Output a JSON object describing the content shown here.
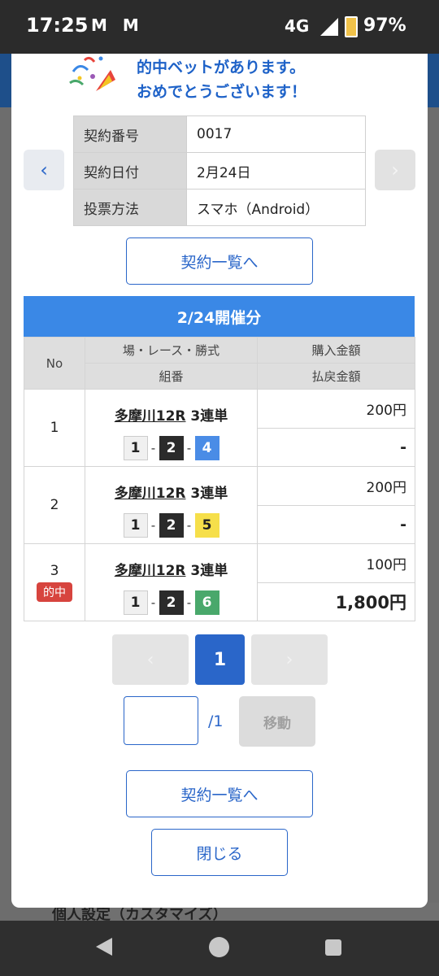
{
  "status_bar": {
    "time": "17:25",
    "notification_icons": "M M",
    "network": "4G",
    "battery": "97%"
  },
  "celebration": {
    "line1": "的中ベットがあります。",
    "line2": "おめでとうございます！"
  },
  "contract": {
    "rows": [
      {
        "label": "契約番号",
        "value": "0017"
      },
      {
        "label": "契約日付",
        "value": "2月24日"
      },
      {
        "label": "投票方法",
        "value": "スマホ（Android）"
      }
    ],
    "prev_icon": "‹",
    "next_icon": "›"
  },
  "list_button_label": "契約一覧へ",
  "section_title": "2/24開催分",
  "bet_table": {
    "headers": {
      "no": "No",
      "race": "場・レース・勝式",
      "combo": "組番",
      "purchase": "購入金額",
      "payout": "払戻金額"
    },
    "rows": [
      {
        "no": "1",
        "venue": "多摩川12R",
        "bet_type": "3連単",
        "first": "1",
        "second": "2",
        "third": "4",
        "amount": "200円",
        "payout": "-",
        "hit": ""
      },
      {
        "no": "2",
        "venue": "多摩川12R",
        "bet_type": "3連単",
        "first": "1",
        "second": "2",
        "third": "5",
        "amount": "200円",
        "payout": "-",
        "hit": ""
      },
      {
        "no": "3",
        "venue": "多摩川12R",
        "bet_type": "3連単",
        "first": "1",
        "second": "2",
        "third": "6",
        "amount": "100円",
        "payout": "1,800円",
        "hit": "的中"
      }
    ],
    "separator": "-"
  },
  "pagination": {
    "prev_icon": "‹",
    "current": "1",
    "next_icon": "›",
    "total": "/1",
    "move_label": "移動",
    "input_value": ""
  },
  "close_label": "閉じる",
  "background_text": "個人設定（カスタマイズ）",
  "colors": {
    "accent": "#2a66c9",
    "header_blue": "#3a88e6",
    "hit_red": "#d7443e"
  }
}
